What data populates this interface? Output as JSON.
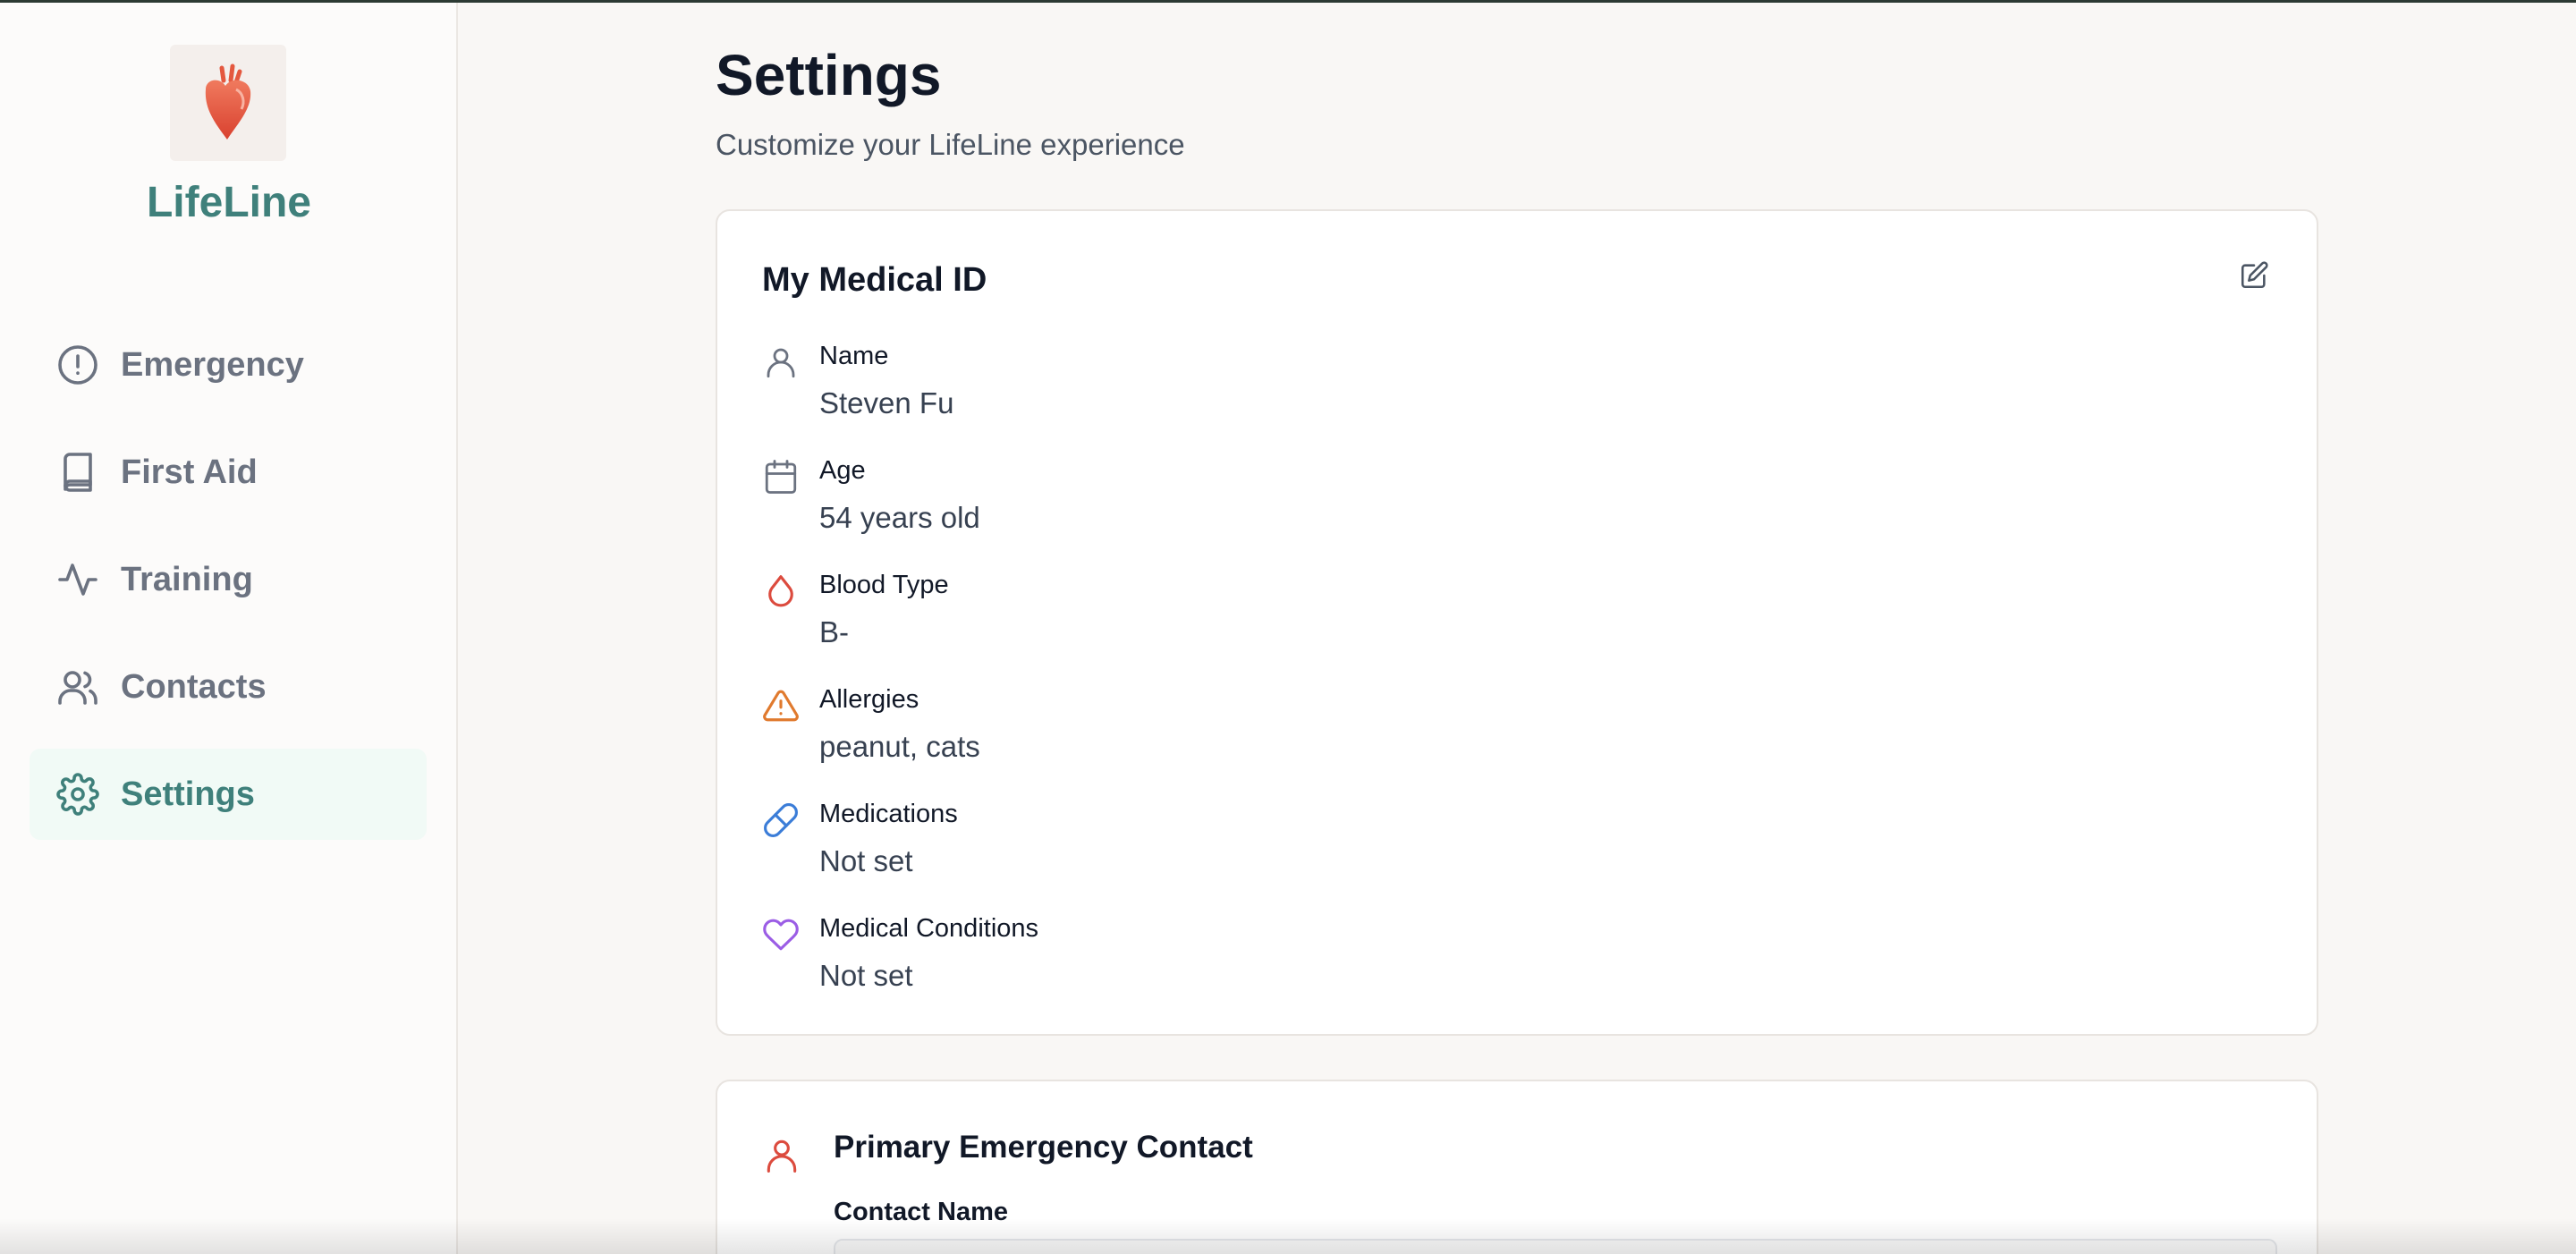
{
  "app": {
    "name": "LifeLine"
  },
  "sidebar": {
    "items": [
      {
        "label": "Emergency",
        "icon": "alert-circle-icon",
        "active": false
      },
      {
        "label": "First Aid",
        "icon": "book-icon",
        "active": false
      },
      {
        "label": "Training",
        "icon": "activity-icon",
        "active": false
      },
      {
        "label": "Contacts",
        "icon": "users-icon",
        "active": false
      },
      {
        "label": "Settings",
        "icon": "gear-icon",
        "active": true
      }
    ]
  },
  "page": {
    "title": "Settings",
    "subtitle": "Customize your LifeLine experience"
  },
  "medical_id": {
    "title": "My Medical ID",
    "edit_icon": "edit-icon",
    "fields": [
      {
        "label": "Name",
        "value": "Steven Fu",
        "icon": "user-icon",
        "color": "#6b7280"
      },
      {
        "label": "Age",
        "value": "54 years old",
        "icon": "calendar-icon",
        "color": "#6b7280"
      },
      {
        "label": "Blood Type",
        "value": "B-",
        "icon": "droplet-icon",
        "color": "#dc4b3e"
      },
      {
        "label": "Allergies",
        "value": "peanut, cats",
        "icon": "warning-icon",
        "color": "#e07a2e"
      },
      {
        "label": "Medications",
        "value": "Not set",
        "icon": "pill-icon",
        "color": "#3b7dd8"
      },
      {
        "label": "Medical Conditions",
        "value": "Not set",
        "icon": "heart-icon",
        "color": "#9b5de5"
      }
    ]
  },
  "emergency_contact": {
    "title": "Primary Emergency Contact",
    "icon": "user-icon",
    "contact_name_label": "Contact Name",
    "contact_name_value": ""
  },
  "colors": {
    "brand": "#3f807b",
    "active_bg": "#f1faf6",
    "nav_text": "#6b7280",
    "contact_icon": "#dc4b3e"
  }
}
